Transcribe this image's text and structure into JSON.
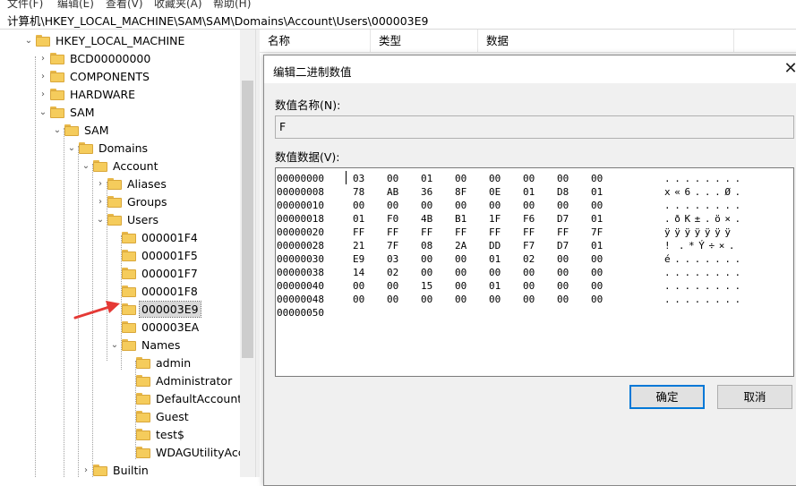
{
  "menubar": {
    "items": [
      "文件(F)",
      "编辑(E)",
      "查看(V)",
      "收藏夹(A)",
      "帮助(H)"
    ]
  },
  "address": "计算机\\HKEY_LOCAL_MACHINE\\SAM\\SAM\\Domains\\Account\\Users\\000003E9",
  "tree": [
    {
      "label": "HKEY_LOCAL_MACHINE",
      "expanded": true
    },
    {
      "label": "BCD00000000",
      "expanded": false
    },
    {
      "label": "COMPONENTS",
      "expanded": false
    },
    {
      "label": "HARDWARE",
      "expanded": false
    },
    {
      "label": "SAM",
      "expanded": true
    },
    {
      "label": "SAM",
      "expanded": true
    },
    {
      "label": "Domains",
      "expanded": true
    },
    {
      "label": "Account",
      "expanded": true
    },
    {
      "label": "Aliases",
      "expanded": false
    },
    {
      "label": "Groups",
      "expanded": false
    },
    {
      "label": "Users",
      "expanded": true
    },
    {
      "label": "000001F4"
    },
    {
      "label": "000001F5"
    },
    {
      "label": "000001F7"
    },
    {
      "label": "000001F8"
    },
    {
      "label": "000003E9",
      "selected": true
    },
    {
      "label": "000003EA"
    },
    {
      "label": "Names",
      "expanded": true
    },
    {
      "label": "admin"
    },
    {
      "label": "Administrator"
    },
    {
      "label": "DefaultAccount"
    },
    {
      "label": "Guest"
    },
    {
      "label": "test$"
    },
    {
      "label": "WDAGUtilityAccount"
    },
    {
      "label": "Builtin",
      "expanded": false
    }
  ],
  "list_columns": [
    "名称",
    "类型",
    "数据"
  ],
  "dialog": {
    "title": "编辑二进制数值",
    "close_glyph": "✕",
    "value_name_label": "数值名称(N):",
    "value_name": "F",
    "value_data_label": "数值数据(V):",
    "hex_rows": [
      {
        "addr": "00000000",
        "bytes": [
          "03",
          "00",
          "01",
          "00",
          "00",
          "00",
          "00",
          "00"
        ],
        "ascii": "........"
      },
      {
        "addr": "00000008",
        "bytes": [
          "78",
          "AB",
          "36",
          "8F",
          "0E",
          "01",
          "D8",
          "01"
        ],
        "ascii": "x«6...Ø."
      },
      {
        "addr": "00000010",
        "bytes": [
          "00",
          "00",
          "00",
          "00",
          "00",
          "00",
          "00",
          "00"
        ],
        "ascii": "........"
      },
      {
        "addr": "00000018",
        "bytes": [
          "01",
          "F0",
          "4B",
          "B1",
          "1F",
          "F6",
          "D7",
          "01"
        ],
        "ascii": ".ðK±.ö×."
      },
      {
        "addr": "00000020",
        "bytes": [
          "FF",
          "FF",
          "FF",
          "FF",
          "FF",
          "FF",
          "FF",
          "7F"
        ],
        "ascii": "ÿÿÿÿÿÿÿ"
      },
      {
        "addr": "00000028",
        "bytes": [
          "21",
          "7F",
          "08",
          "2A",
          "DD",
          "F7",
          "D7",
          "01"
        ],
        "ascii": "!.*Ý÷×."
      },
      {
        "addr": "00000030",
        "bytes": [
          "E9",
          "03",
          "00",
          "00",
          "01",
          "02",
          "00",
          "00"
        ],
        "ascii": "é......."
      },
      {
        "addr": "00000038",
        "bytes": [
          "14",
          "02",
          "00",
          "00",
          "00",
          "00",
          "00",
          "00"
        ],
        "ascii": "........"
      },
      {
        "addr": "00000040",
        "bytes": [
          "00",
          "00",
          "15",
          "00",
          "01",
          "00",
          "00",
          "00"
        ],
        "ascii": "........"
      },
      {
        "addr": "00000048",
        "bytes": [
          "00",
          "00",
          "00",
          "00",
          "00",
          "00",
          "00",
          "00"
        ],
        "ascii": "........"
      },
      {
        "addr": "00000050",
        "bytes": [],
        "ascii": ""
      }
    ],
    "ok_label": "确定",
    "cancel_label": "取消"
  },
  "colors": {
    "accent": "#0078d7",
    "arrow": "#e53935",
    "folder": "#f5cc5c"
  }
}
